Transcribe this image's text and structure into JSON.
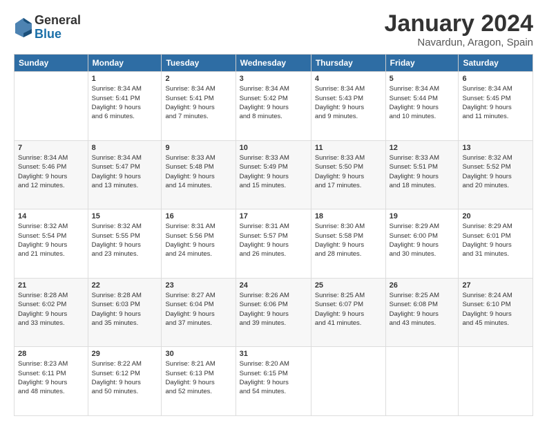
{
  "logo": {
    "general": "General",
    "blue": "Blue"
  },
  "header": {
    "title": "January 2024",
    "location": "Navardun, Aragon, Spain"
  },
  "weekdays": [
    "Sunday",
    "Monday",
    "Tuesday",
    "Wednesday",
    "Thursday",
    "Friday",
    "Saturday"
  ],
  "weeks": [
    [
      {
        "day": "",
        "content": ""
      },
      {
        "day": "1",
        "content": "Sunrise: 8:34 AM\nSunset: 5:41 PM\nDaylight: 9 hours\nand 6 minutes."
      },
      {
        "day": "2",
        "content": "Sunrise: 8:34 AM\nSunset: 5:41 PM\nDaylight: 9 hours\nand 7 minutes."
      },
      {
        "day": "3",
        "content": "Sunrise: 8:34 AM\nSunset: 5:42 PM\nDaylight: 9 hours\nand 8 minutes."
      },
      {
        "day": "4",
        "content": "Sunrise: 8:34 AM\nSunset: 5:43 PM\nDaylight: 9 hours\nand 9 minutes."
      },
      {
        "day": "5",
        "content": "Sunrise: 8:34 AM\nSunset: 5:44 PM\nDaylight: 9 hours\nand 10 minutes."
      },
      {
        "day": "6",
        "content": "Sunrise: 8:34 AM\nSunset: 5:45 PM\nDaylight: 9 hours\nand 11 minutes."
      }
    ],
    [
      {
        "day": "7",
        "content": "Sunrise: 8:34 AM\nSunset: 5:46 PM\nDaylight: 9 hours\nand 12 minutes."
      },
      {
        "day": "8",
        "content": "Sunrise: 8:34 AM\nSunset: 5:47 PM\nDaylight: 9 hours\nand 13 minutes."
      },
      {
        "day": "9",
        "content": "Sunrise: 8:33 AM\nSunset: 5:48 PM\nDaylight: 9 hours\nand 14 minutes."
      },
      {
        "day": "10",
        "content": "Sunrise: 8:33 AM\nSunset: 5:49 PM\nDaylight: 9 hours\nand 15 minutes."
      },
      {
        "day": "11",
        "content": "Sunrise: 8:33 AM\nSunset: 5:50 PM\nDaylight: 9 hours\nand 17 minutes."
      },
      {
        "day": "12",
        "content": "Sunrise: 8:33 AM\nSunset: 5:51 PM\nDaylight: 9 hours\nand 18 minutes."
      },
      {
        "day": "13",
        "content": "Sunrise: 8:32 AM\nSunset: 5:52 PM\nDaylight: 9 hours\nand 20 minutes."
      }
    ],
    [
      {
        "day": "14",
        "content": "Sunrise: 8:32 AM\nSunset: 5:54 PM\nDaylight: 9 hours\nand 21 minutes."
      },
      {
        "day": "15",
        "content": "Sunrise: 8:32 AM\nSunset: 5:55 PM\nDaylight: 9 hours\nand 23 minutes."
      },
      {
        "day": "16",
        "content": "Sunrise: 8:31 AM\nSunset: 5:56 PM\nDaylight: 9 hours\nand 24 minutes."
      },
      {
        "day": "17",
        "content": "Sunrise: 8:31 AM\nSunset: 5:57 PM\nDaylight: 9 hours\nand 26 minutes."
      },
      {
        "day": "18",
        "content": "Sunrise: 8:30 AM\nSunset: 5:58 PM\nDaylight: 9 hours\nand 28 minutes."
      },
      {
        "day": "19",
        "content": "Sunrise: 8:29 AM\nSunset: 6:00 PM\nDaylight: 9 hours\nand 30 minutes."
      },
      {
        "day": "20",
        "content": "Sunrise: 8:29 AM\nSunset: 6:01 PM\nDaylight: 9 hours\nand 31 minutes."
      }
    ],
    [
      {
        "day": "21",
        "content": "Sunrise: 8:28 AM\nSunset: 6:02 PM\nDaylight: 9 hours\nand 33 minutes."
      },
      {
        "day": "22",
        "content": "Sunrise: 8:28 AM\nSunset: 6:03 PM\nDaylight: 9 hours\nand 35 minutes."
      },
      {
        "day": "23",
        "content": "Sunrise: 8:27 AM\nSunset: 6:04 PM\nDaylight: 9 hours\nand 37 minutes."
      },
      {
        "day": "24",
        "content": "Sunrise: 8:26 AM\nSunset: 6:06 PM\nDaylight: 9 hours\nand 39 minutes."
      },
      {
        "day": "25",
        "content": "Sunrise: 8:25 AM\nSunset: 6:07 PM\nDaylight: 9 hours\nand 41 minutes."
      },
      {
        "day": "26",
        "content": "Sunrise: 8:25 AM\nSunset: 6:08 PM\nDaylight: 9 hours\nand 43 minutes."
      },
      {
        "day": "27",
        "content": "Sunrise: 8:24 AM\nSunset: 6:10 PM\nDaylight: 9 hours\nand 45 minutes."
      }
    ],
    [
      {
        "day": "28",
        "content": "Sunrise: 8:23 AM\nSunset: 6:11 PM\nDaylight: 9 hours\nand 48 minutes."
      },
      {
        "day": "29",
        "content": "Sunrise: 8:22 AM\nSunset: 6:12 PM\nDaylight: 9 hours\nand 50 minutes."
      },
      {
        "day": "30",
        "content": "Sunrise: 8:21 AM\nSunset: 6:13 PM\nDaylight: 9 hours\nand 52 minutes."
      },
      {
        "day": "31",
        "content": "Sunrise: 8:20 AM\nSunset: 6:15 PM\nDaylight: 9 hours\nand 54 minutes."
      },
      {
        "day": "",
        "content": ""
      },
      {
        "day": "",
        "content": ""
      },
      {
        "day": "",
        "content": ""
      }
    ]
  ]
}
